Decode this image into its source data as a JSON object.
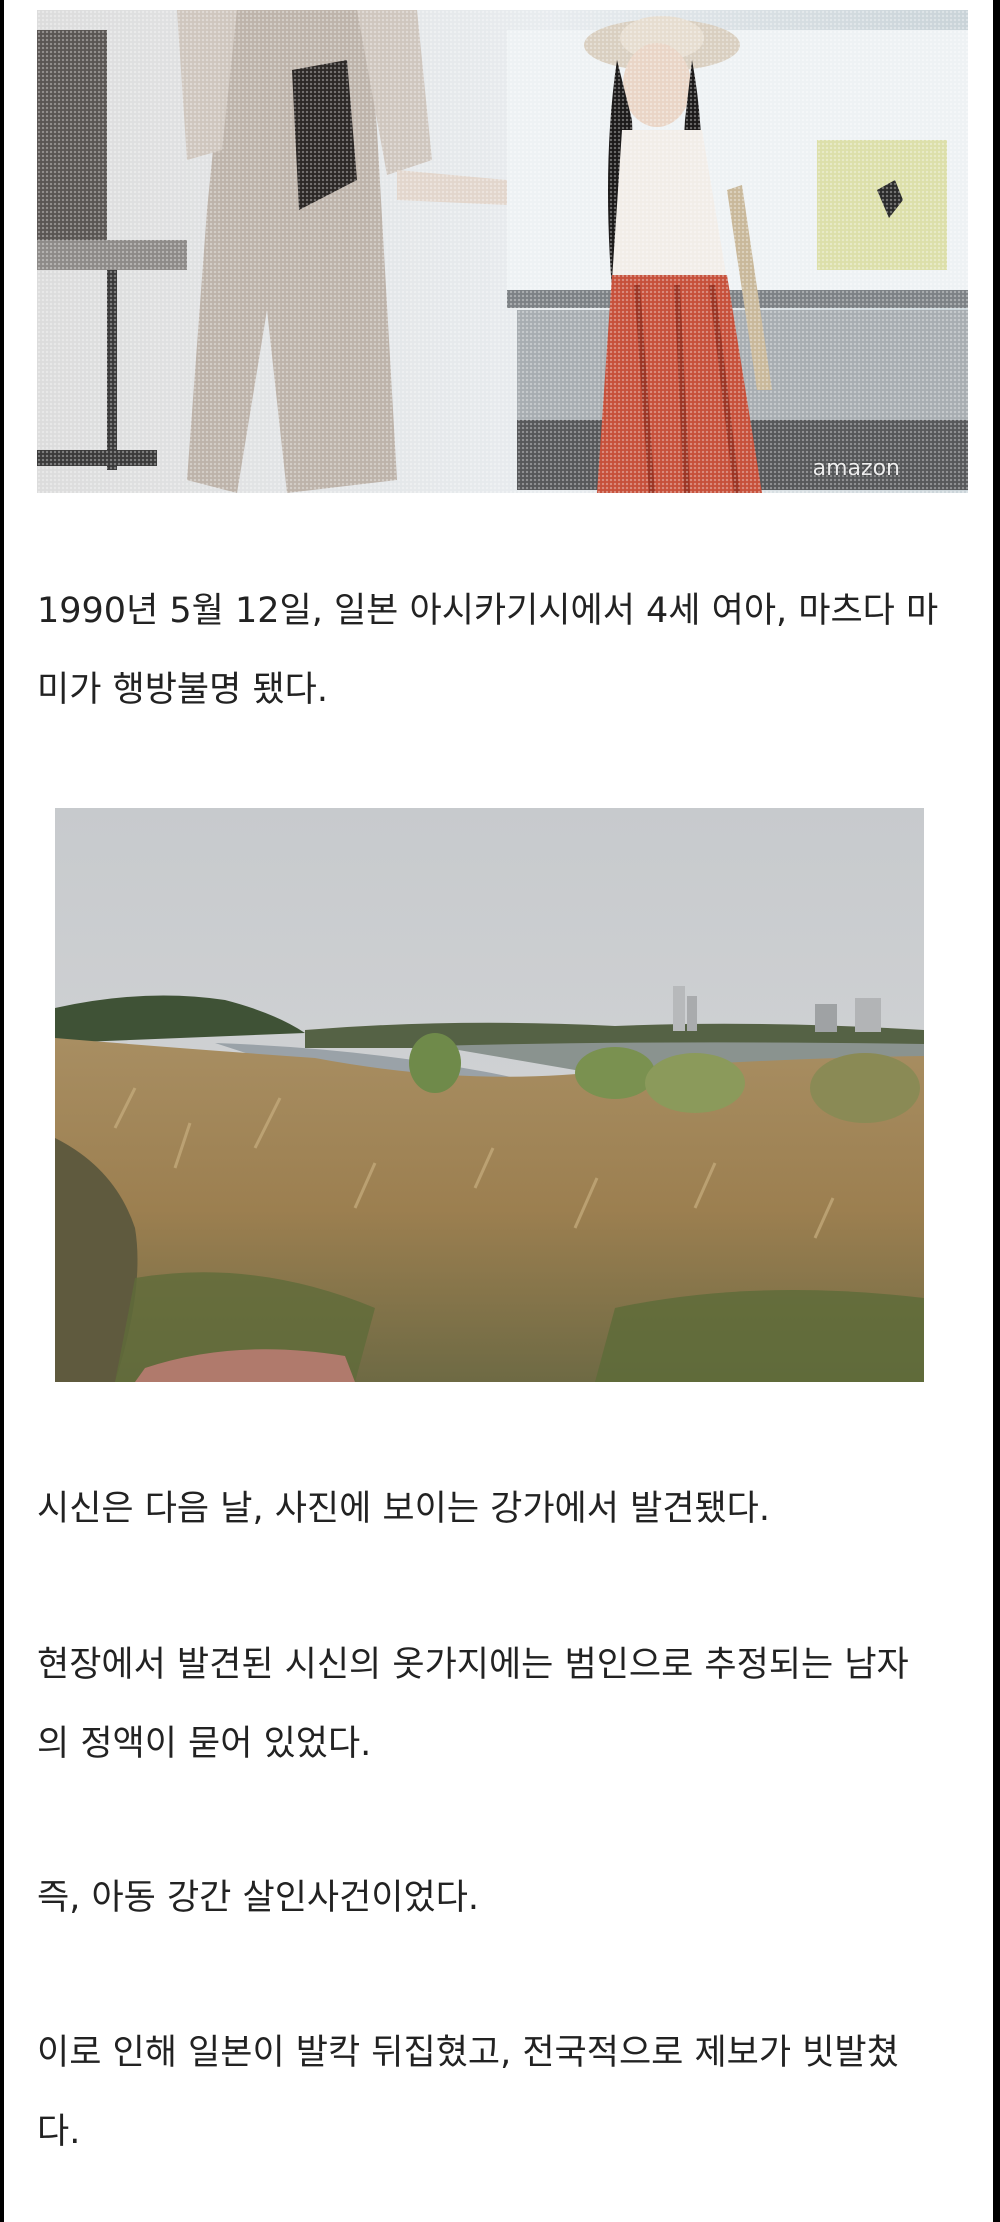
{
  "photo_top": {
    "watermark": "amazon"
  },
  "paragraphs": [
    "1990년 5월 12일, 일본 아시카기시에서 4세 여아, 마츠다 마\n미가 행방불명 됐다.",
    "시신은 다음 날, 사진에 보이는 강가에서 발견됐다.",
    "현장에서 발견된 시신의 옷가지에는 범인으로 추정되는 남자\n의 정액이 묻어 있었다.",
    "즉, 아동 강간 살인사건이었다.",
    "이로 인해 일본이 발칵 뒤집혔고, 전국적으로 제보가 빗발쳤\n다."
  ]
}
